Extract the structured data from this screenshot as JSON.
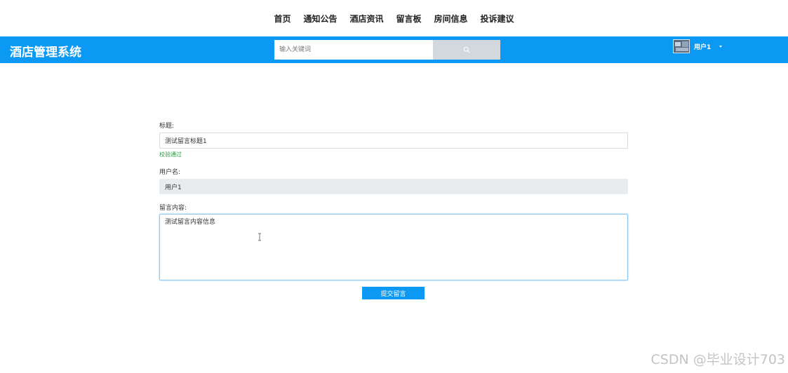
{
  "top_nav": {
    "items": [
      {
        "label": "首页"
      },
      {
        "label": "通知公告"
      },
      {
        "label": "酒店资讯"
      },
      {
        "label": "留言板"
      },
      {
        "label": "房间信息"
      },
      {
        "label": "投诉建议"
      }
    ]
  },
  "header": {
    "brand": "酒店管理系统",
    "accent_color": "#0c99f4",
    "search": {
      "placeholder": "输入关键词",
      "value": "",
      "button_icon": "search-icon"
    },
    "user": {
      "name": "用户1",
      "avatar_icon": "avatar-image",
      "dropdown_icon": "caret-down-icon"
    }
  },
  "form": {
    "title_label": "标题:",
    "title_value": "测试留言标题1",
    "title_validation": "校验通过",
    "username_label": "用户名:",
    "username_value": "用户1",
    "content_label": "留言内容:",
    "content_value": "测试留言内容信息",
    "submit_label": "提交留言"
  },
  "watermark": "CSDN @毕业设计703"
}
